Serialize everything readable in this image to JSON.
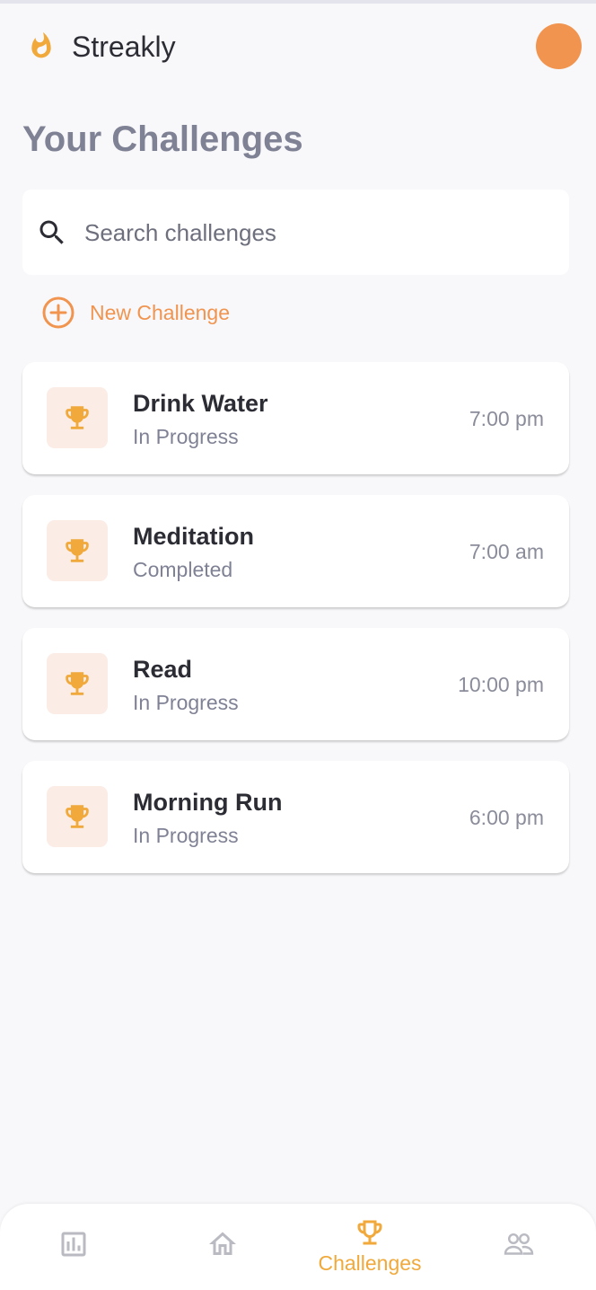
{
  "app": {
    "name": "Streakly"
  },
  "page": {
    "title": "Your Challenges"
  },
  "search": {
    "placeholder": "Search challenges",
    "value": ""
  },
  "new_challenge": {
    "label": "New Challenge"
  },
  "challenges": [
    {
      "name": "Drink Water",
      "status": "In Progress",
      "time": "7:00 pm"
    },
    {
      "name": "Meditation",
      "status": "Completed",
      "time": "7:00 am"
    },
    {
      "name": "Read",
      "status": "In Progress",
      "time": "10:00 pm"
    },
    {
      "name": "Morning Run",
      "status": "In Progress",
      "time": "6:00 pm"
    }
  ],
  "bottom_nav": {
    "items": [
      {
        "icon": "bar-chart-icon",
        "label": "",
        "active": false
      },
      {
        "icon": "home-icon",
        "label": "",
        "active": false
      },
      {
        "icon": "trophy-icon",
        "label": "Challenges",
        "active": true
      },
      {
        "icon": "people-icon",
        "label": "",
        "active": false
      }
    ]
  },
  "colors": {
    "accent": "#f0944f",
    "trophy": "#f0a93a",
    "trophy_bg": "#fbece5",
    "title_gray": "#7f8194",
    "background": "#f8f8fa"
  },
  "icons": {
    "logo": "flame-icon",
    "search": "search-icon",
    "new": "plus-circle-icon",
    "challenge": "trophy-icon"
  }
}
